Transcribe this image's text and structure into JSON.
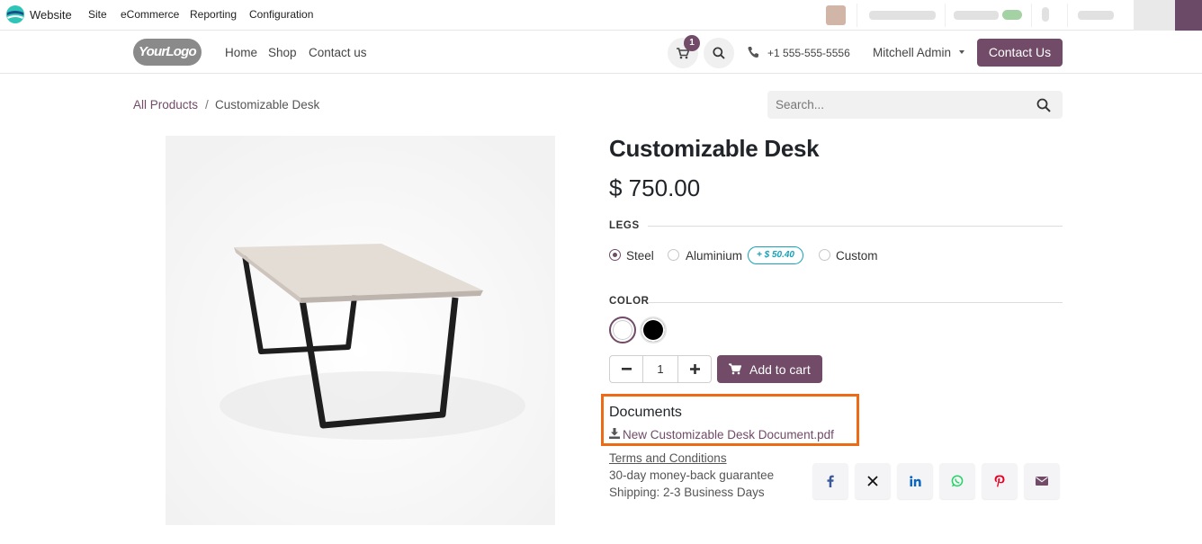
{
  "admin_bar": {
    "app_name": "Website",
    "menus": [
      "Site",
      "eCommerce",
      "Reporting",
      "Configuration"
    ]
  },
  "header": {
    "logo_text": "YourLogo",
    "nav": [
      "Home",
      "Shop",
      "Contact us"
    ],
    "cart_count": "1",
    "phone": "+1 555-555-5556",
    "user": "Mitchell Admin",
    "contact_button": "Contact Us"
  },
  "breadcrumb": {
    "parent": "All Products",
    "separator": "/",
    "current": "Customizable Desk"
  },
  "search": {
    "placeholder": "Search..."
  },
  "product": {
    "name": "Customizable Desk",
    "price": "$ 750.00",
    "legs": {
      "heading": "LEGS",
      "options": [
        "Steel",
        "Aluminium",
        "Custom"
      ],
      "selected": "Steel",
      "extra_price": "+ $ 50.40"
    },
    "color": {
      "heading": "COLOR",
      "swatches": [
        "#ffffff",
        "#000000"
      ],
      "selected": "#ffffff"
    },
    "quantity": "1",
    "add_to_cart": "Add to cart"
  },
  "documents": {
    "title": "Documents",
    "file": "New Customizable Desk Document.pdf"
  },
  "info": {
    "terms": "Terms and Conditions",
    "guarantee": "30-day money-back guarantee",
    "shipping": "Shipping: 2-3 Business Days"
  },
  "share_icons": [
    "facebook-icon",
    "x-icon",
    "linkedin-icon",
    "whatsapp-icon",
    "pinterest-icon",
    "envelope-icon"
  ],
  "colors": {
    "primary": "#714b67",
    "highlight": "#ee6b16",
    "extra_badge": "#17a2b8"
  }
}
